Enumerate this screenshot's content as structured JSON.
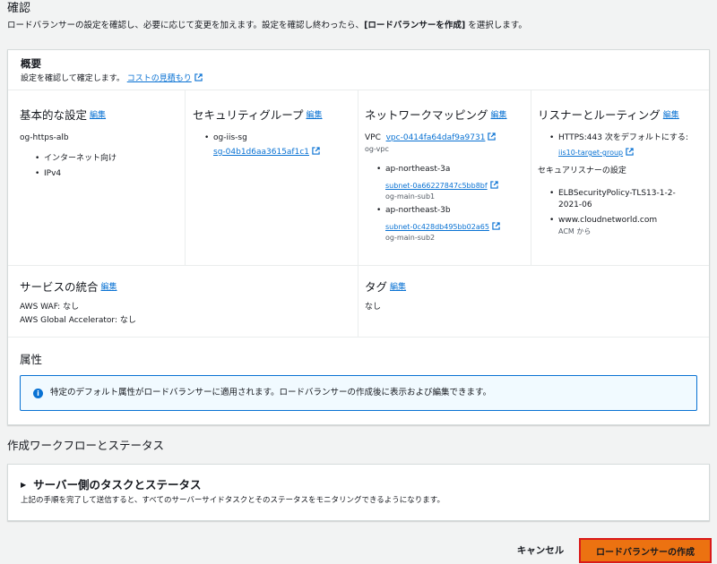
{
  "header": {
    "title": "確認",
    "desc_pre": "ロードバランサーの設定を確認し、必要に応じて変更を加えます。設定を確認し終わったら、",
    "desc_bold": "[ロードバランサーを作成]",
    "desc_post": " を選択します。"
  },
  "summary": {
    "title": "概要",
    "desc": "設定を確認して確定します。",
    "cost_link": "コストの見積もり"
  },
  "edit_label": "編集",
  "basic": {
    "title": "基本的な設定",
    "name": "og-https-alb",
    "items": [
      "インターネット向け",
      "IPv4"
    ]
  },
  "security": {
    "title": "セキュリティグループ",
    "sg_name": "og-iis-sg",
    "sg_id": "sg-04b1d6aa3615af1c1"
  },
  "network": {
    "title": "ネットワークマッピング",
    "vpc_label": "VPC",
    "vpc_id": "vpc-0414fa64daf9a9731",
    "vpc_name": "og-vpc",
    "zones": [
      {
        "az": "ap-northeast-3a",
        "subnet_id": "subnet-0a66227847c5bb8bf",
        "subnet_name": "og-main-sub1"
      },
      {
        "az": "ap-northeast-3b",
        "subnet_id": "subnet-0c428db495bb02a65",
        "subnet_name": "og-main-sub2"
      }
    ]
  },
  "listener": {
    "title": "リスナーとルーティング",
    "listener_text": "HTTPS:443 次をデフォルトにする:",
    "target_group": "iis10-target-group",
    "secure_title": "セキュアリスナーの設定",
    "policy_line1": "ELBSecurityPolicy-TLS13-1-2-",
    "policy_line2": "2021-06",
    "cert": "www.cloudnetworld.com",
    "cert_source": "ACM から"
  },
  "integrations": {
    "title": "サービスの統合",
    "waf": "AWS WAF: なし",
    "ga": "AWS Global Accelerator: なし"
  },
  "tags": {
    "title": "タグ",
    "value": "なし"
  },
  "attributes": {
    "title": "属性",
    "info": "特定のデフォルト属性がロードバランサーに適用されます。ロードバランサーの作成後に表示および編集できます。"
  },
  "workflow": {
    "title": "作成ワークフローとステータス",
    "section_title": "サーバー側のタスクとステータス",
    "section_desc": "上記の手順を完了して送信すると、すべてのサーバーサイドタスクとそのステータスをモニタリングできるようになります。"
  },
  "actions": {
    "cancel": "キャンセル",
    "create": "ロードバランサーの作成"
  },
  "colors": {
    "link": "#0972d3",
    "primary_button": "#ec7211",
    "highlight_border": "#d91a1a",
    "info_border": "#0972d3"
  }
}
